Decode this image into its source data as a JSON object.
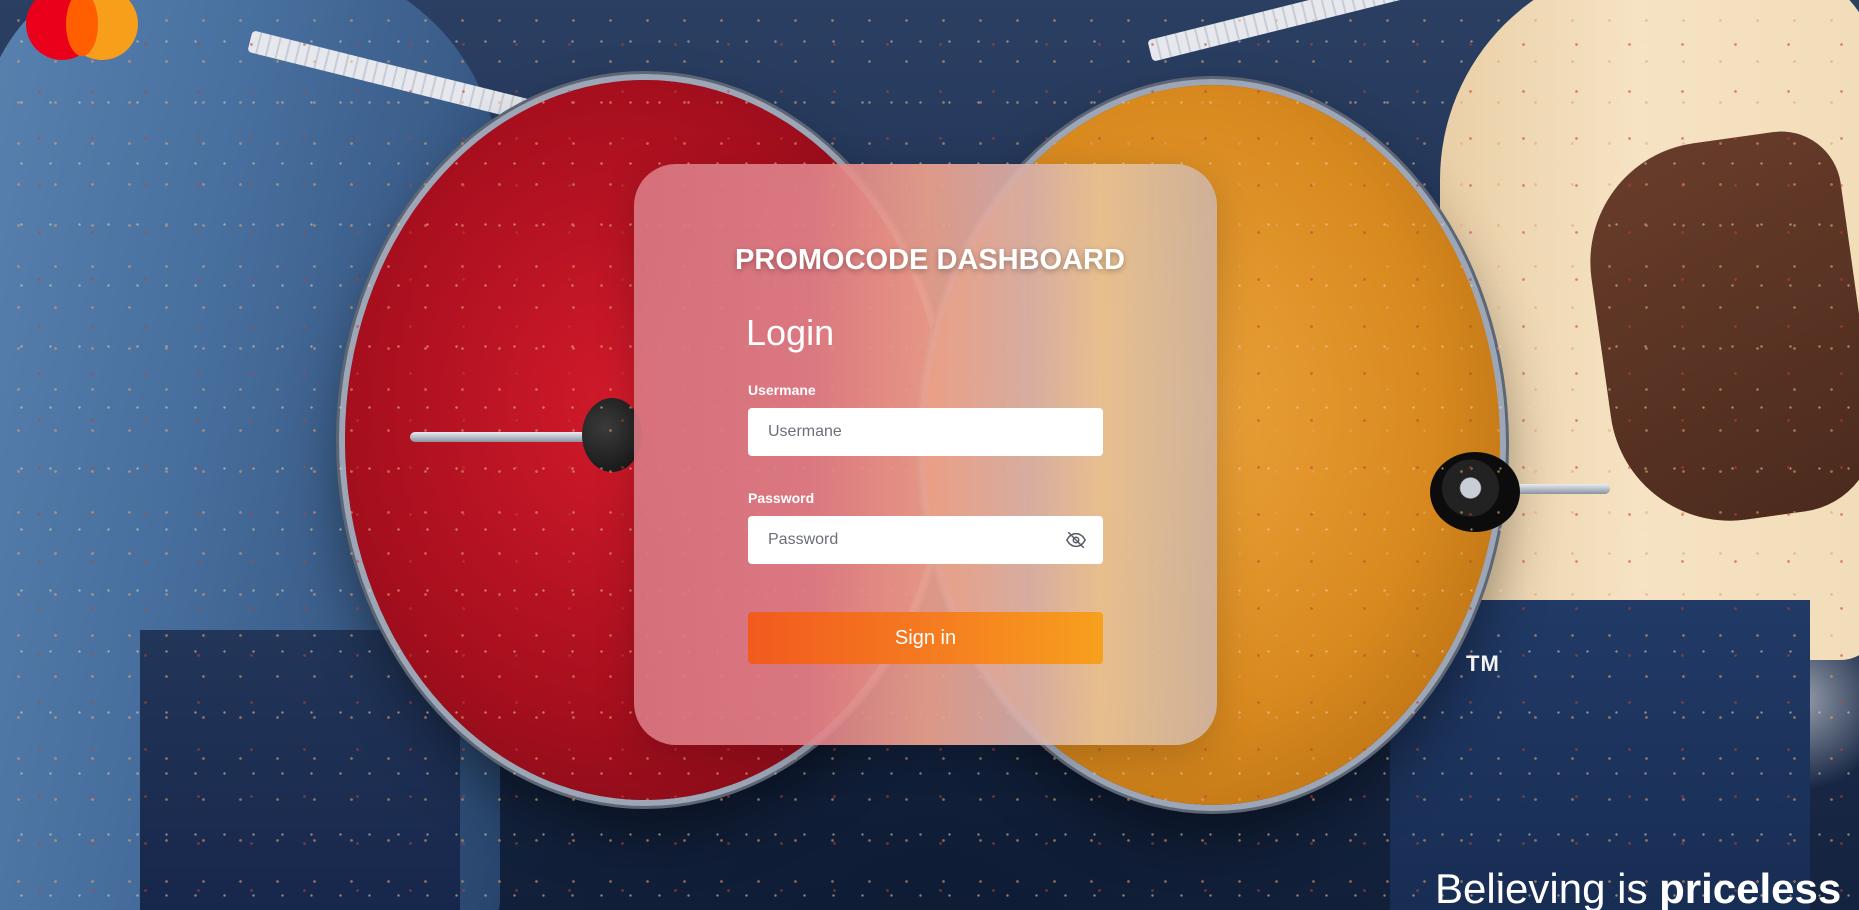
{
  "brand": {
    "logo": "mastercard-logo",
    "colors": {
      "red": "#eb001b",
      "orange": "#f79e1b",
      "overlap": "#ff5f00"
    },
    "trademark": "TM",
    "tagline_regular": "Believing is ",
    "tagline_bold": "priceless"
  },
  "card": {
    "title": "PROMOCODE DASHBOARD",
    "heading": "Login"
  },
  "form": {
    "username": {
      "label": "Usermane",
      "placeholder": "Usermane",
      "value": ""
    },
    "password": {
      "label": "Password",
      "placeholder": "Password",
      "value": "",
      "toggle_icon": "eye-off-icon"
    },
    "submit_label": "Sign in",
    "submit_colors": [
      "#f25a1e",
      "#f7a01e"
    ]
  }
}
